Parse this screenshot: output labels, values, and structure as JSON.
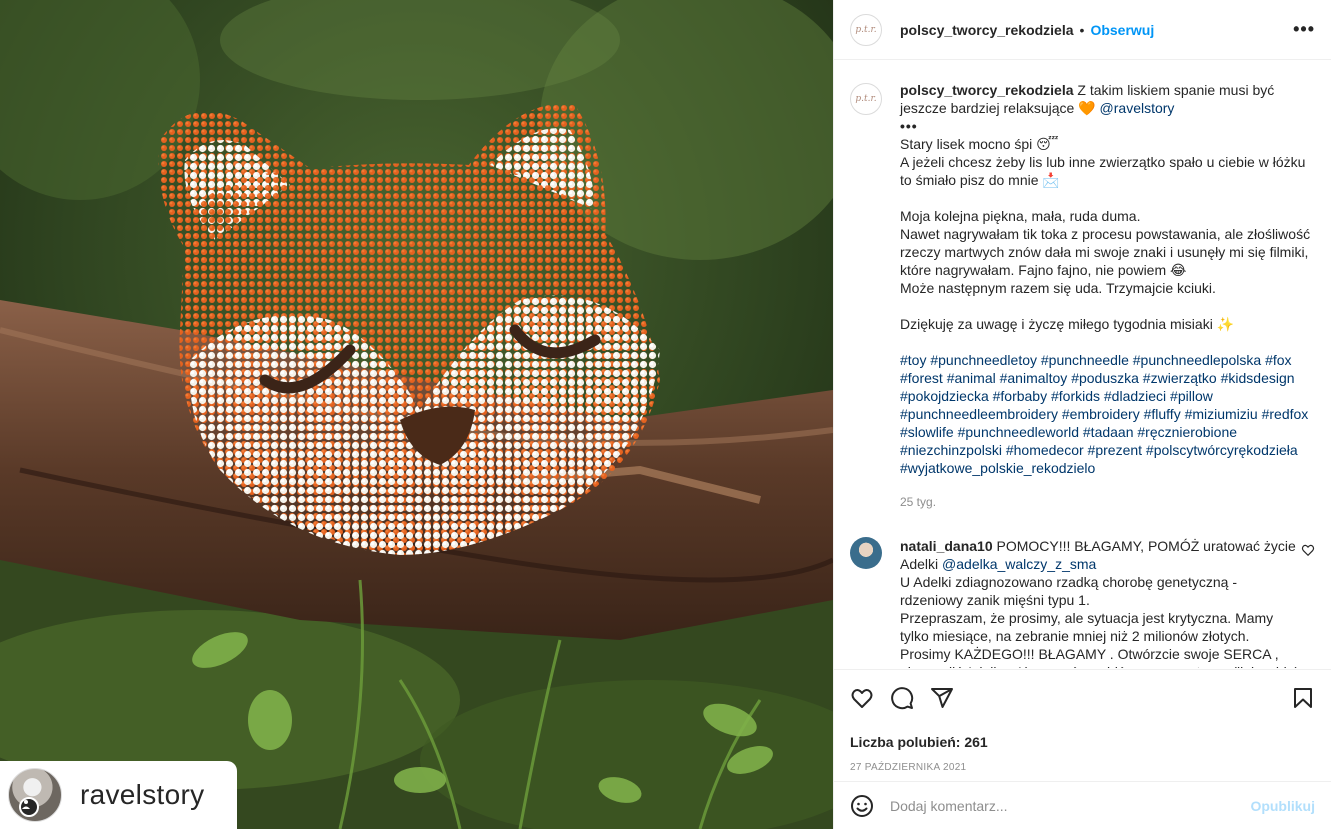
{
  "photo": {
    "alt_icon": "fox-pillow-photo",
    "user_tag": {
      "name": "ravelstory",
      "badge_icon": "user-icon"
    }
  },
  "header": {
    "username": "polscy_tworcy_rekodziela",
    "dot": "•",
    "follow_label": "Obserwuj",
    "more_icon": "•••",
    "avatar_text": "p.t.r."
  },
  "caption": {
    "username": "polscy_tworcy_rekodziela",
    "line1": "Z takim liskiem spanie musi być jeszcze bardziej relaksujące",
    "heart": "🧡",
    "mention": "@ravelstory",
    "more": "•••",
    "p1": "Stary lisek mocno śpi 😴",
    "p2": "A jeżeli chcesz żeby lis lub inne zwierzątko spało u ciebie w łóżku to śmiało pisz do mnie 📩",
    "p3": "Moja kolejna piękna, mała, ruda duma.",
    "p4": "Nawet nagrywałam tik toka z procesu powstawania, ale złośliwość rzeczy martwych znów dała mi swoje znaki i usunęły mi się filmiki, które nagrywałam. Fajno fajno, nie powiem 😂",
    "p5": "Może następnym razem się uda. Trzymajcie kciuki.",
    "p6": "Dziękuję za uwagę i życzę miłego tygodnia misiaki ✨",
    "hashtags": "#toy #punchneedletoy #punchneedle #punchneedlepolska #fox #forest #animal #animaltoy #poduszka #zwierzątko #kidsdesign #pokojdziecka #forbaby #forkids #dladzieci #pillow #punchneedleembroidery #embroidery #fluffy #miziumiziu #redfox #slowlife #punchneedleworld #tadaan #ręcznierobione #niezchinzpolski #homedecor #prezent #polscytwórcyrękodzieła #wyjatkowe_polskie_rekodzielo",
    "time": "25 tyg."
  },
  "comment": {
    "username": "natali_dana10",
    "text1": "POMOCY!!! BŁAGAMY, POMÓŻ uratować życie Adelki",
    "mention": "@adelka_walczy_z_sma",
    "text2": "U Adelki zdiagnozowano rzadką chorobę genetyczną - rdzeniowy zanik mięśni typu 1.",
    "text3": "Przepraszam, że prosimy, ale sytuacja jest krytyczna. Mamy tylko miesiące, na zebranie mniej niż 2 milionów złotych.",
    "text4": "Prosimy KAŻDEGO!!! BŁAGAMY . Otwórzcie swoje SERCA , aby ocalić Adelkę. Aby pomóc wejdź na naszą stronę (link w bio) i przekaż pomoc."
  },
  "actions": {
    "likes": "Liczba polubień: 261",
    "date": "27 PAŹDZIERNIKA 2021"
  },
  "add_comment": {
    "placeholder": "Dodaj komentarz...",
    "post_label": "Opublikuj"
  }
}
